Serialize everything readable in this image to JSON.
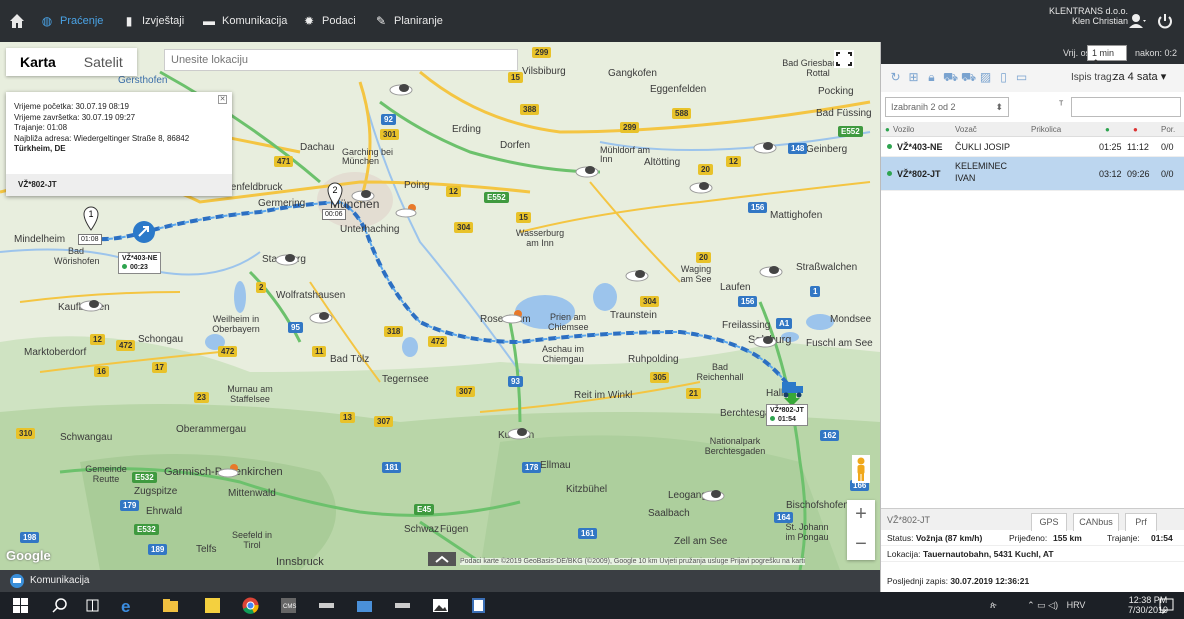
{
  "nav": {
    "items": [
      {
        "label": "Praćenje",
        "icon": "globe-icon",
        "active": true
      },
      {
        "label": "Izvještaji",
        "icon": "bar-chart-icon"
      },
      {
        "label": "Komunikacija",
        "icon": "chat-icon"
      },
      {
        "label": "Podaci",
        "icon": "gear-icon"
      },
      {
        "label": "Planiranje",
        "icon": "pencil-icon"
      }
    ],
    "company": "KLENTRANS d.o.o.",
    "user": "Klen Christian"
  },
  "map": {
    "type_map": "Karta",
    "type_satellite": "Satelit",
    "search_placeholder": "Unesite lokaciju",
    "footer": "Podaci karte ©2019 GeoBasis-DE/BKG (©2009), Google   10 km   Uvjeti pružanja usluge   Prijavi pogrešku na karti",
    "google": "Google",
    "towns": [
      "Gersthofen",
      "Dachau",
      "Garching bei München",
      "Erding",
      "Dorfen",
      "Mühldorf am Inn",
      "Altötting",
      "Eggenfelden",
      "Vilsbiburg",
      "Gangkofen",
      "Bad Griesbach im Rottal",
      "Pocking",
      "Bad Füssing",
      "Geinberg",
      "Mattighofen",
      "Fürstenfeldbruck",
      "Germering",
      "München",
      "Poing",
      "Unterhaching",
      "Wasserburg am Inn",
      "Waging am See",
      "Laufen",
      "Straßwalchen",
      "Mindelheim",
      "Bad Wörishofen",
      "Starnberg",
      "Wolfratshausen",
      "Weilheim in Oberbayern",
      "Kaufbeuren",
      "Schongau",
      "Marktoberdorf",
      "Bad Tölz",
      "Rosenheim",
      "Prien am Chiemsee",
      "Traunstein",
      "Freilassing",
      "Salzburg",
      "Mondsee",
      "Fuschl am See",
      "Aschau im Chiemgau",
      "Ruhpolding",
      "Bad Reichenhall",
      "Tegernsee",
      "Murnau am Staffelsee",
      "Reit im Winkl",
      "Berchtesgaden",
      "Nationalpark Berchtesgaden",
      "Schwangau",
      "Oberammergau",
      "Kufstein",
      "Ellmau",
      "Gemeinde Reutte",
      "Garmisch-Partenkirchen",
      "Mittenwald",
      "Zugspitze",
      "Ehrwald",
      "Seefeld in Tirol",
      "Telfs",
      "Innsbruck",
      "Kitzbühel",
      "Leogang",
      "Saalbach",
      "Bischofshofen",
      "St. Johann im Pongau",
      "Zell am See",
      "Schwaz",
      "Fügen",
      "Hallein"
    ],
    "infowindow": {
      "start": "Vrijeme početka: 30.07.19 08:19",
      "end": "Vrijeme završetka: 30.07.19 09:27",
      "duration": "Trajanje: 01:08",
      "address1": "Najbliža adresa: Wiedergeltinger Straße 8, 86842",
      "address2": "Türkheim, DE",
      "vehicle": "VŽ*802-JT"
    },
    "markers": [
      {
        "vehicle": "VŽ*403-NE",
        "time": "00:23"
      },
      {
        "vehicle": "VŽ*802-JT",
        "time": "01:54"
      }
    ],
    "stops": [
      {
        "num": "1",
        "time": "01:08"
      },
      {
        "num": "2",
        "time": "00:06"
      }
    ]
  },
  "panel": {
    "refresh_label": "Vrij. osv:",
    "refresh_value": "1 min",
    "after_label": "nakon: 0:2",
    "ispis_label": "Ispis trag:",
    "ispis_value": "za 4 sata",
    "filter": "Izabranih 2 od 2",
    "columns": [
      "Vozilo",
      "Vozač",
      "Prikolica",
      "",
      "",
      "Por."
    ],
    "rows": [
      {
        "vehicle": "VŽ*403-NE",
        "driver": "ČUKLI JOSIP",
        "driver2": "",
        "t1": "01:25",
        "t2": "11:12",
        "por": "0/0",
        "selected": false
      },
      {
        "vehicle": "VŽ*802-JT",
        "driver": "KELEMINEC",
        "driver2": "IVAN",
        "t1": "03:12",
        "t2": "09:26",
        "por": "0/0",
        "selected": true
      }
    ],
    "bottom": {
      "vehicle": "VŽ*802-JT",
      "tabs": [
        "GPS",
        "CANbus",
        "Prf"
      ],
      "status_label": "Status:",
      "status": "Vožnja (87 km/h)",
      "distance_label": "Prijeđeno:",
      "distance": "155 km",
      "duration_label": "Trajanje:",
      "duration": "01:54",
      "location_label": "Lokacija:",
      "location": "Tauernautobahn, 5431 Kuchl, AT",
      "last_label": "Posljednji zapis:",
      "last": "30.07.2019 12:36:21"
    }
  },
  "statusbar": {
    "label": "Komunikacija"
  },
  "taskbar": {
    "time": "12:38 PM",
    "date": "7/30/2019",
    "lang": "HRV"
  }
}
